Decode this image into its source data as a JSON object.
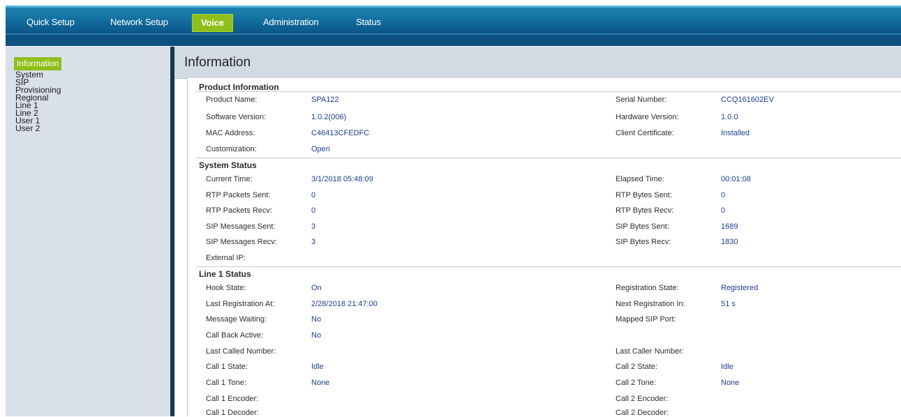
{
  "nav": {
    "tabs": [
      "Quick Setup",
      "Network Setup",
      "Voice",
      "Administration",
      "Status"
    ],
    "active_tab": "Voice"
  },
  "sidebar": {
    "items": [
      "Information",
      "System",
      "SIP",
      "Provisioning",
      "Regional",
      "Line 1",
      "Line 2",
      "User 1",
      "User 2"
    ],
    "active_item": "Information"
  },
  "page": {
    "title": "Information"
  },
  "product_information": {
    "header": "Product Information",
    "rows": [
      {
        "label": "Product Name:",
        "value": "SPA122",
        "label2": "Serial Number:",
        "value2": "CCQ161602EV"
      },
      {
        "label": "Software Version:",
        "value": "1.0.2(006)",
        "label2": "Hardware Version:",
        "value2": "1.0.0"
      },
      {
        "label": "MAC Address:",
        "value": "C46413CFEDFC",
        "label2": "Client Certificate:",
        "value2": "Installed"
      },
      {
        "label": "Customization:",
        "value": "Open",
        "label2": "",
        "value2": ""
      }
    ]
  },
  "system_status": {
    "header": "System Status",
    "rows": [
      {
        "label": "Current Time:",
        "value": "3/1/2018 05:48:09",
        "label2": "Elapsed Time:",
        "value2": "00:01:08"
      },
      {
        "label": "RTP Packets Sent:",
        "value": "0",
        "label2": "RTP Bytes Sent:",
        "value2": "0"
      },
      {
        "label": "RTP Packets Recv:",
        "value": "0",
        "label2": "RTP Bytes Recv:",
        "value2": "0"
      },
      {
        "label": "SIP Messages Sent:",
        "value": "3",
        "label2": "SIP Bytes Sent:",
        "value2": "1689"
      },
      {
        "label": "SIP Messages Recv:",
        "value": "3",
        "label2": "SIP Bytes Recv:",
        "value2": "1830"
      },
      {
        "label": "External IP:",
        "value": "",
        "label2": "",
        "value2": ""
      }
    ]
  },
  "line1_status": {
    "header": "Line 1 Status",
    "rows": [
      {
        "label": "Hook State:",
        "value": "On",
        "label2": "Registration State:",
        "value2": "Registered"
      },
      {
        "label": "Last Registration At:",
        "value": "2/28/2018 21:47:00",
        "label2": "Next Registration In:",
        "value2": "51 s"
      },
      {
        "label": "Message Waiting:",
        "value": "No",
        "label2": "Mapped SIP Port:",
        "value2": ""
      },
      {
        "label": "Call Back Active:",
        "value": "No",
        "label2": "",
        "value2": ""
      },
      {
        "label": "Last Called Number:",
        "value": "",
        "label2": "Last Caller Number:",
        "value2": ""
      },
      {
        "label": "Call 1 State:",
        "value": "Idle",
        "label2": "Call 2 State:",
        "value2": "Idle"
      },
      {
        "label": "Call 1 Tone:",
        "value": "None",
        "label2": "Call 2 Tone:",
        "value2": "None"
      },
      {
        "label": "Call 1 Encoder:",
        "value": "",
        "label2": "Call 2 Encoder:",
        "value2": ""
      },
      {
        "label": "Call 1 Decoder:",
        "value": "",
        "label2": "Call 2 Decoder:",
        "value2": ""
      }
    ]
  }
}
